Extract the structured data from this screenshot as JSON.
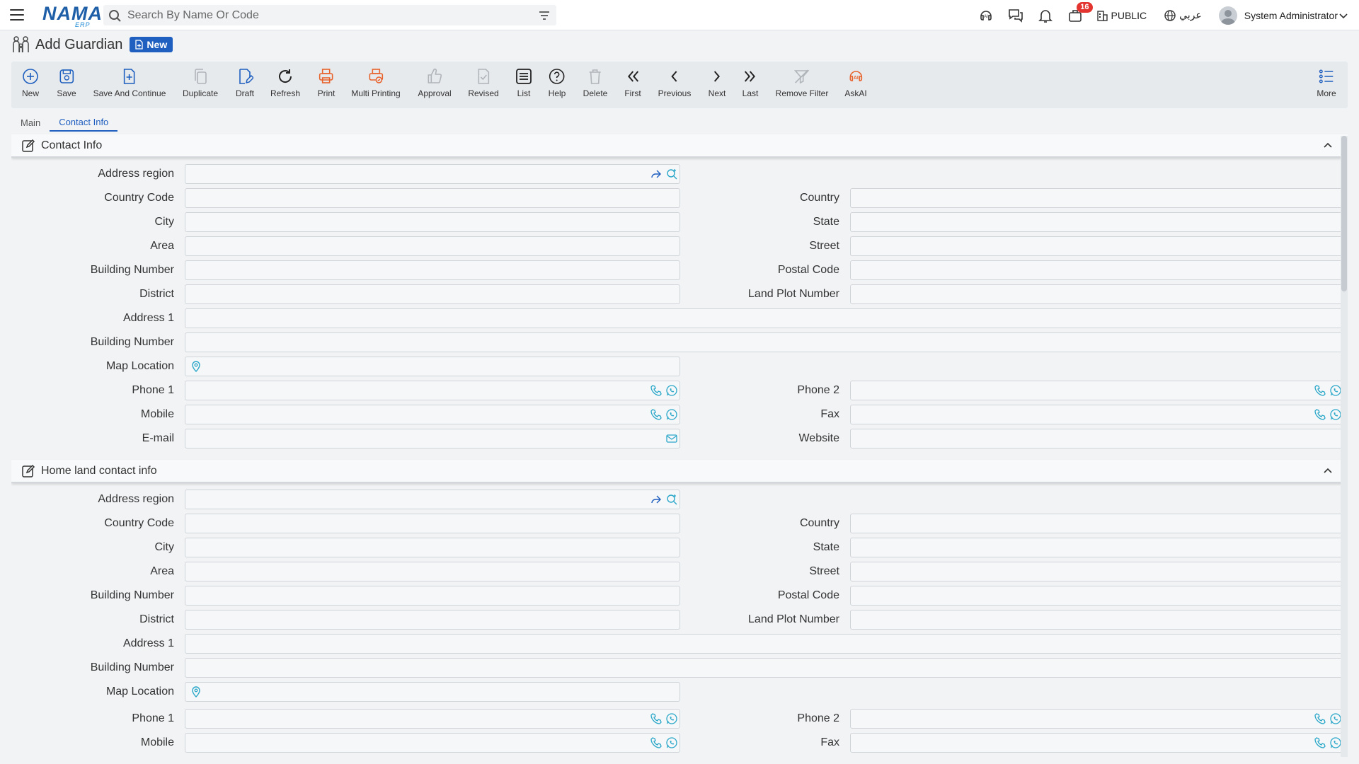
{
  "app": {
    "logo_text": "NAMA",
    "logo_sub": "ERP",
    "search_placeholder": "Search By Name Or Code",
    "notification_count": "16",
    "branch": "PUBLIC",
    "language": "عربي",
    "user": "System Administrator"
  },
  "page": {
    "title": "Add Guardian",
    "mode_badge": "New"
  },
  "toolbar": {
    "new": "New",
    "save": "Save",
    "save_continue": "Save And Continue",
    "duplicate": "Duplicate",
    "draft": "Draft",
    "refresh": "Refresh",
    "print": "Print",
    "multi_printing": "Multi Printing",
    "approval": "Approval",
    "revised": "Revised",
    "list": "List",
    "help": "Help",
    "delete": "Delete",
    "first": "First",
    "previous": "Previous",
    "next": "Next",
    "last": "Last",
    "remove_filter": "Remove Filter",
    "askai": "AskAI",
    "more": "More"
  },
  "tabs": {
    "main": "Main",
    "contact_info": "Contact Info"
  },
  "sections": {
    "contact": {
      "title": "Contact Info",
      "address_region": "Address region",
      "country_code": "Country Code",
      "country": "Country",
      "city": "City",
      "state": "State",
      "area": "Area",
      "street": "Street",
      "building_number": "Building Number",
      "postal_code": "Postal Code",
      "district": "District",
      "land_plot_number": "Land Plot Number",
      "address1": "Address 1",
      "building_number2": "Building Number",
      "map_location": "Map Location",
      "phone1": "Phone 1",
      "phone2": "Phone 2",
      "mobile": "Mobile",
      "fax": "Fax",
      "email": "E-mail",
      "website": "Website"
    },
    "homeland": {
      "title": "Home land contact info",
      "address_region": "Address region",
      "country_code": "Country Code",
      "country": "Country",
      "city": "City",
      "state": "State",
      "area": "Area",
      "street": "Street",
      "building_number": "Building Number",
      "postal_code": "Postal Code",
      "district": "District",
      "land_plot_number": "Land Plot Number",
      "address1": "Address 1",
      "building_number2": "Building Number",
      "map_location": "Map Location",
      "phone1": "Phone 1",
      "phone2": "Phone 2",
      "mobile": "Mobile",
      "fax": "Fax"
    }
  },
  "colors": {
    "accent": "#1f5fbf",
    "orange": "#e8622c",
    "field_icon": "#2aa7c9",
    "badge_red": "#e3342f"
  }
}
